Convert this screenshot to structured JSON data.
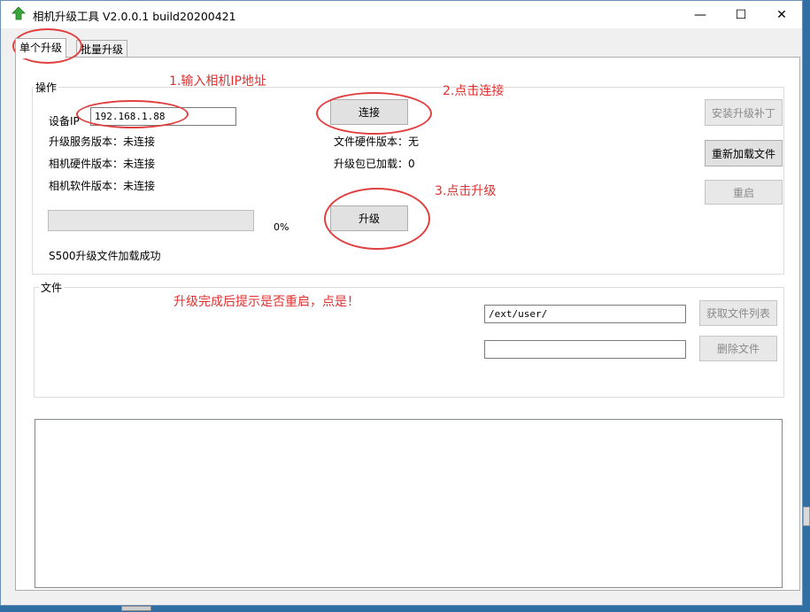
{
  "window": {
    "title": "相机升级工具 V2.0.0.1 build20200421"
  },
  "tabs": [
    "单个升级",
    "批量升级"
  ],
  "operation": {
    "group_label": "操作",
    "device_ip_label": "设备IP",
    "device_ip_value": "192.168.1.88",
    "connect_button": "连接",
    "server_version": "升级服务版本：未连接",
    "camera_hw_version": "相机硬件版本：未连接",
    "camera_sw_version": "相机软件版本：未连接",
    "file_hw_version": "文件硬件版本：无",
    "package_loaded": "升级包已加载：0",
    "upgrade_button": "升级",
    "progress_percent": "0%",
    "progress_value": 0,
    "status_message": "S500升级文件加载成功",
    "install_patch_button": "安装升级补丁",
    "reload_file_button": "重新加载文件",
    "restart_button": "重启"
  },
  "file_section": {
    "group_label": "文件",
    "path_value": "/ext/user/",
    "delete_value": "",
    "get_file_list_button": "获取文件列表",
    "delete_file_button": "删除文件"
  },
  "annotations": {
    "step1": "1.输入相机IP地址",
    "step2": "2.点击连接",
    "step3": "3.点击升级",
    "note": "升级完成后提示是否重启，点是！"
  },
  "colors": {
    "annotation": "#e0302f",
    "title_icon": "#3aa53a"
  }
}
